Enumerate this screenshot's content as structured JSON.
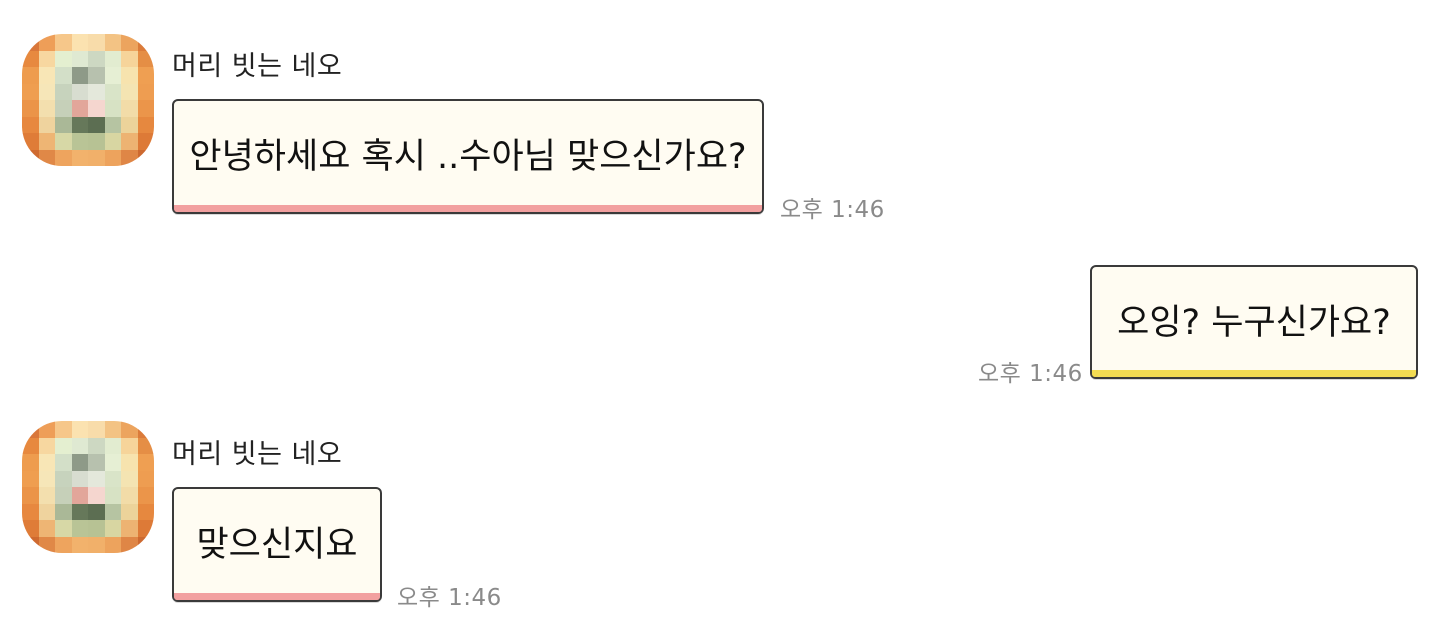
{
  "colors": {
    "incoming_stripe": "#f2a0a0",
    "outgoing_stripe": "#f3dc52",
    "bubble_bg": "#fffcf2",
    "timestamp": "#8a8a8a"
  },
  "messages": [
    {
      "direction": "incoming",
      "sender": "머리 빗는 네오",
      "text": "안녕하세요 혹시 ..수아님 맞으신가요?",
      "time": "오후 1:46",
      "icon": "avatar-icon"
    },
    {
      "direction": "outgoing",
      "text": "오잉? 누구신가요?",
      "time": "오후 1:46"
    },
    {
      "direction": "incoming",
      "sender": "머리 빗는 네오",
      "text": "맞으신지요",
      "time": "오후 1:46",
      "icon": "avatar-icon"
    }
  ]
}
